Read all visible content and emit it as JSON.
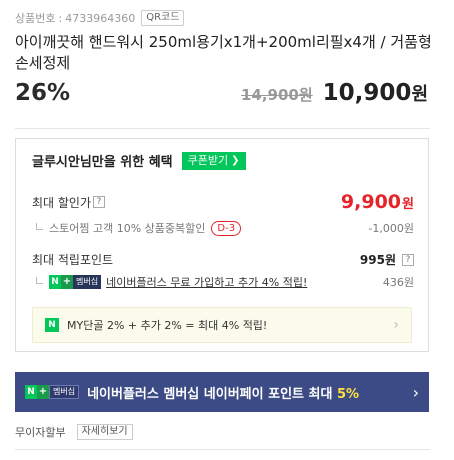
{
  "product": {
    "no_label": "상품번호",
    "sep": ":",
    "no_value": "4733964360",
    "qr_label": "QR코드",
    "title": "아이깨끗해 핸드워시 250ml용기x1개+200ml리필x4개 / 거품형 손세정제"
  },
  "pricing": {
    "discount_rate": "26%",
    "original_price": "14,900원",
    "sale_price": "10,900",
    "sale_unit": "원"
  },
  "benefits": {
    "title": "글루시안님만을 위한 혜택",
    "coupon_button": "쿠폰받기",
    "coupon_arrow": "❯",
    "max_discount": {
      "label": "최대 할인가",
      "help": "?",
      "price": "9,900",
      "unit": "원"
    },
    "store_coupon": {
      "label": "스토어찜 고객 10% 상품중복할인",
      "badge": "D-3",
      "value": "-1,000원"
    },
    "points": {
      "label": "최대 적립포인트",
      "value": "995원",
      "help": "?"
    },
    "naver_plus": {
      "badge_n": "N",
      "badge_plus": "+",
      "badge_member": "멤버십",
      "link": "네이버플러스 무료 가입하고 추가 4% 적립!",
      "value": "436원"
    },
    "my_box": {
      "icon": "N",
      "text": "MY단골 2% + 추가 2% = 최대 4% 적립!",
      "chevron": "›"
    }
  },
  "banner": {
    "badge_n": "N",
    "badge_plus": "+",
    "badge_member": "멤버십",
    "text": "네이버플러스 멤버십 네이버페이 포인트 최대 ",
    "highlight": "5%",
    "chevron": "›"
  },
  "installment": {
    "label": "무이자할부",
    "detail_button": "자세히보기"
  },
  "colors": {
    "naver_green": "#03c75a",
    "sale_red": "#e5252a",
    "banner_navy": "#3c4a85",
    "highlight_yellow": "#ffe13c"
  }
}
